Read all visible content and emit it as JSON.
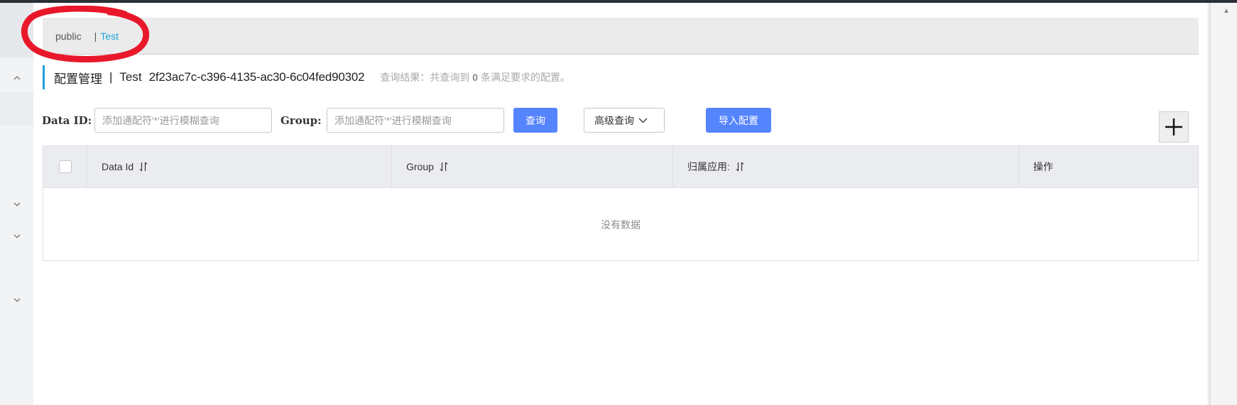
{
  "namespaces": {
    "items": [
      "public",
      "Test"
    ],
    "separator": "|",
    "active": "Test"
  },
  "title": {
    "main": "配置管理",
    "separator": "|",
    "namespace": "Test",
    "namespace_id": "2f23ac7c-c396-4135-ac30-6c04fed90302",
    "result_text_prefix": "查询结果：共查询到",
    "result_count": "0",
    "result_text_suffix": "条满足要求的配置。"
  },
  "filters": {
    "data_id_label": "Data ID:",
    "data_id_placeholder": "添加通配符'*'进行模糊查询",
    "group_label": "Group:",
    "group_placeholder": "添加通配符'*'进行模糊查询",
    "query_button": "查询",
    "advanced_button": "高级查询",
    "import_button": "导入配置"
  },
  "table": {
    "columns": [
      "Data Id",
      "Group",
      "归属应用:",
      "操作"
    ],
    "sortable": [
      true,
      true,
      true,
      false
    ],
    "rows": [],
    "empty_text": "没有数据"
  },
  "colors": {
    "accent": "#5584ff",
    "link": "#1fa4d8",
    "title_border": "#1f9ed8",
    "annotation": "#e8182a"
  },
  "icons": {
    "add": "plus-icon",
    "sort": "sort-icon",
    "advanced": "chevron-down-icon",
    "sidebar": [
      "chevron-up-icon",
      "chevron-down-icon",
      "chevron-down-icon",
      "chevron-down-icon"
    ]
  }
}
